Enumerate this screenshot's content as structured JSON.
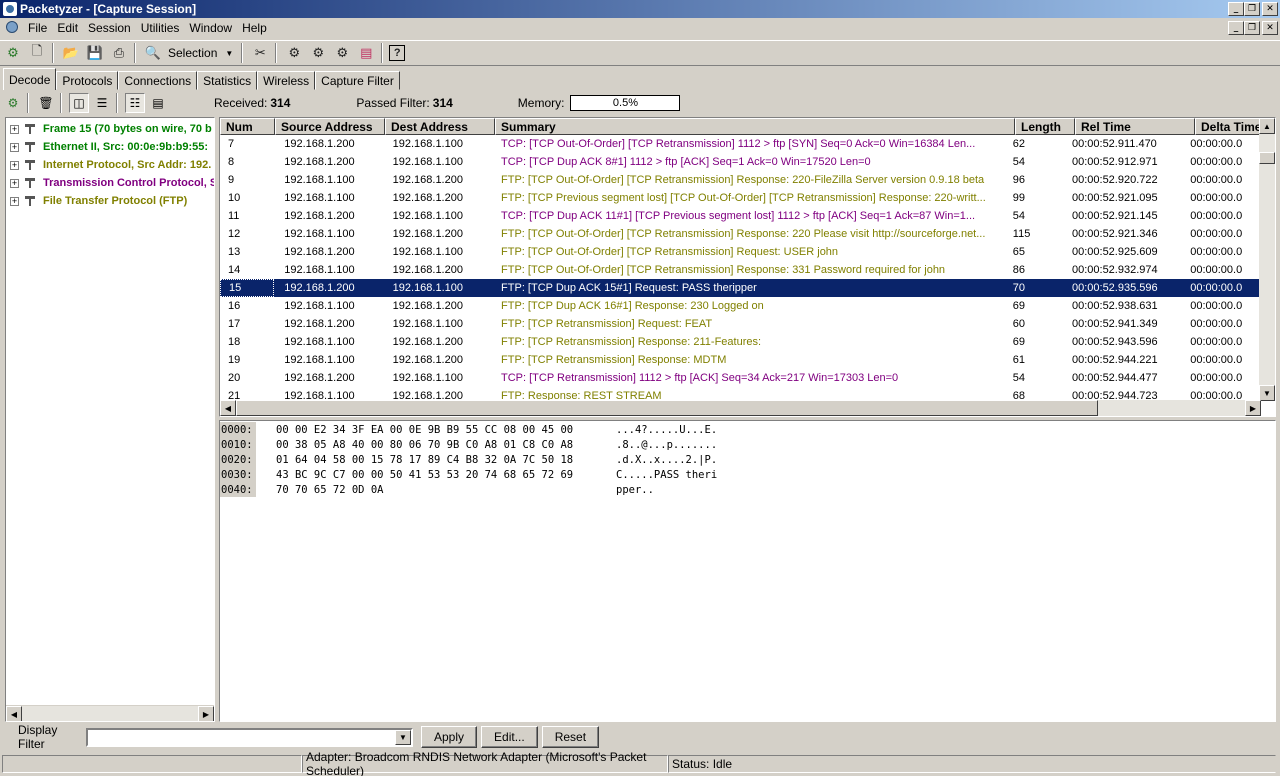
{
  "window": {
    "title": "Packetyzer - [Capture Session]"
  },
  "menu": [
    "File",
    "Edit",
    "Session",
    "Utilities",
    "Window",
    "Help"
  ],
  "toolbar": {
    "selection_label": "Selection"
  },
  "tabs": [
    "Decode",
    "Protocols",
    "Connections",
    "Statistics",
    "Wireless",
    "Capture Filter"
  ],
  "stats": {
    "received_label": "Received:",
    "received_value": "314",
    "passed_label": "Passed Filter:",
    "passed_value": "314",
    "memory_label": "Memory:",
    "memory_value": "0.5%"
  },
  "tree": [
    {
      "label": "Frame 15 (70 bytes on wire, 70 b",
      "color": "#008000"
    },
    {
      "label": "Ethernet II, Src: 00:0e:9b:b9:55:",
      "color": "#008000"
    },
    {
      "label": "Internet Protocol, Src Addr: 192.",
      "color": "#808000"
    },
    {
      "label": "Transmission Control Protocol, Sr",
      "color": "#800080"
    },
    {
      "label": "File Transfer Protocol (FTP)",
      "color": "#808000"
    }
  ],
  "columns": [
    "Num",
    "Source Address",
    "Dest Address",
    "Summary",
    "Length",
    "Rel Time",
    "Delta Time"
  ],
  "packets": [
    {
      "num": "7",
      "src": "192.168.1.200",
      "dst": "192.168.1.100",
      "summary": "TCP: [TCP Out-Of-Order] [TCP Retransmission] 1112 > ftp [SYN] Seq=0 Ack=0 Win=16384 Len...",
      "len": "62",
      "rel": "00:00:52.911.470",
      "delta": "00:00:00.0",
      "color": "#800080"
    },
    {
      "num": "8",
      "src": "192.168.1.200",
      "dst": "192.168.1.100",
      "summary": "TCP: [TCP Dup ACK 8#1] 1112 > ftp [ACK] Seq=1 Ack=0 Win=17520 Len=0",
      "len": "54",
      "rel": "00:00:52.912.971",
      "delta": "00:00:00.0",
      "color": "#800080"
    },
    {
      "num": "9",
      "src": "192.168.1.100",
      "dst": "192.168.1.200",
      "summary": "FTP: [TCP Out-Of-Order] [TCP Retransmission] Response: 220-FileZilla Server version 0.9.18 beta",
      "len": "96",
      "rel": "00:00:52.920.722",
      "delta": "00:00:00.0",
      "color": "#808000"
    },
    {
      "num": "10",
      "src": "192.168.1.100",
      "dst": "192.168.1.200",
      "summary": "FTP: [TCP Previous segment lost] [TCP Out-Of-Order] [TCP Retransmission] Response: 220-writt...",
      "len": "99",
      "rel": "00:00:52.921.095",
      "delta": "00:00:00.0",
      "color": "#808000"
    },
    {
      "num": "11",
      "src": "192.168.1.200",
      "dst": "192.168.1.100",
      "summary": "TCP: [TCP Dup ACK 11#1] [TCP Previous segment lost] 1112 > ftp [ACK] Seq=1 Ack=87 Win=1...",
      "len": "54",
      "rel": "00:00:52.921.145",
      "delta": "00:00:00.0",
      "color": "#800080"
    },
    {
      "num": "12",
      "src": "192.168.1.100",
      "dst": "192.168.1.200",
      "summary": "FTP: [TCP Out-Of-Order] [TCP Retransmission] Response: 220 Please visit http://sourceforge.net...",
      "len": "115",
      "rel": "00:00:52.921.346",
      "delta": "00:00:00.0",
      "color": "#808000"
    },
    {
      "num": "13",
      "src": "192.168.1.200",
      "dst": "192.168.1.100",
      "summary": "FTP: [TCP Out-Of-Order] [TCP Retransmission] Request: USER john",
      "len": "65",
      "rel": "00:00:52.925.609",
      "delta": "00:00:00.0",
      "color": "#808000"
    },
    {
      "num": "14",
      "src": "192.168.1.100",
      "dst": "192.168.1.200",
      "summary": "FTP: [TCP Out-Of-Order] [TCP Retransmission] Response: 331 Password required for john",
      "len": "86",
      "rel": "00:00:52.932.974",
      "delta": "00:00:00.0",
      "color": "#808000"
    },
    {
      "num": "15",
      "src": "192.168.1.200",
      "dst": "192.168.1.100",
      "summary": "FTP: [TCP Dup ACK 15#1] Request: PASS theripper",
      "len": "70",
      "rel": "00:00:52.935.596",
      "delta": "00:00:00.0",
      "color": "#ffffff",
      "selected": true
    },
    {
      "num": "16",
      "src": "192.168.1.100",
      "dst": "192.168.1.200",
      "summary": "FTP: [TCP Dup ACK 16#1] Response: 230 Logged on",
      "len": "69",
      "rel": "00:00:52.938.631",
      "delta": "00:00:00.0",
      "color": "#808000"
    },
    {
      "num": "17",
      "src": "192.168.1.200",
      "dst": "192.168.1.100",
      "summary": "FTP: [TCP Retransmission] Request: FEAT",
      "len": "60",
      "rel": "00:00:52.941.349",
      "delta": "00:00:00.0",
      "color": "#808000"
    },
    {
      "num": "18",
      "src": "192.168.1.100",
      "dst": "192.168.1.200",
      "summary": "FTP: [TCP Retransmission] Response: 211-Features:",
      "len": "69",
      "rel": "00:00:52.943.596",
      "delta": "00:00:00.0",
      "color": "#808000"
    },
    {
      "num": "19",
      "src": "192.168.1.100",
      "dst": "192.168.1.200",
      "summary": "FTP: [TCP Retransmission] Response:  MDTM",
      "len": "61",
      "rel": "00:00:52.944.221",
      "delta": "00:00:00.0",
      "color": "#808000"
    },
    {
      "num": "20",
      "src": "192.168.1.200",
      "dst": "192.168.1.100",
      "summary": "TCP: [TCP Retransmission] 1112 > ftp [ACK] Seq=34 Ack=217 Win=17303 Len=0",
      "len": "54",
      "rel": "00:00:52.944.477",
      "delta": "00:00:00.0",
      "color": "#800080"
    },
    {
      "num": "21",
      "src": "192.168.1.100",
      "dst": "192.168.1.200",
      "summary": "FTP: Response:  REST STREAM",
      "len": "68",
      "rel": "00:00:52.944.723",
      "delta": "00:00:00.0",
      "color": "#808000"
    }
  ],
  "hex": [
    {
      "off": "0000:",
      "bytes": "00 00 E2 34 3F EA 00 0E 9B B9 55 CC 08 00 45 00",
      "ascii": "...4?.....U...E."
    },
    {
      "off": "0010:",
      "bytes": "00 38 05 A8 40 00 80 06 70 9B C0 A8 01 C8 C0 A8",
      "ascii": ".8..@...p......."
    },
    {
      "off": "0020:",
      "bytes": "01 64 04 58 00 15 78 17 89 C4 B8 32 0A 7C 50 18",
      "ascii": ".d.X..x....2.|P."
    },
    {
      "off": "0030:",
      "bytes": "43 BC 9C C7 00 00 50 41 53 53 20 74 68 65 72 69",
      "ascii": "C.....PASS theri"
    },
    {
      "off": "0040:",
      "bytes": "70 70 65 72 0D 0A",
      "ascii": "pper.."
    }
  ],
  "filter": {
    "label": "Display Filter",
    "value": "",
    "apply": "Apply",
    "edit": "Edit...",
    "reset": "Reset"
  },
  "status": {
    "adapter": "Adapter: Broadcom RNDIS Network Adapter (Microsoft's Packet Scheduler)",
    "state": "Status: Idle"
  }
}
